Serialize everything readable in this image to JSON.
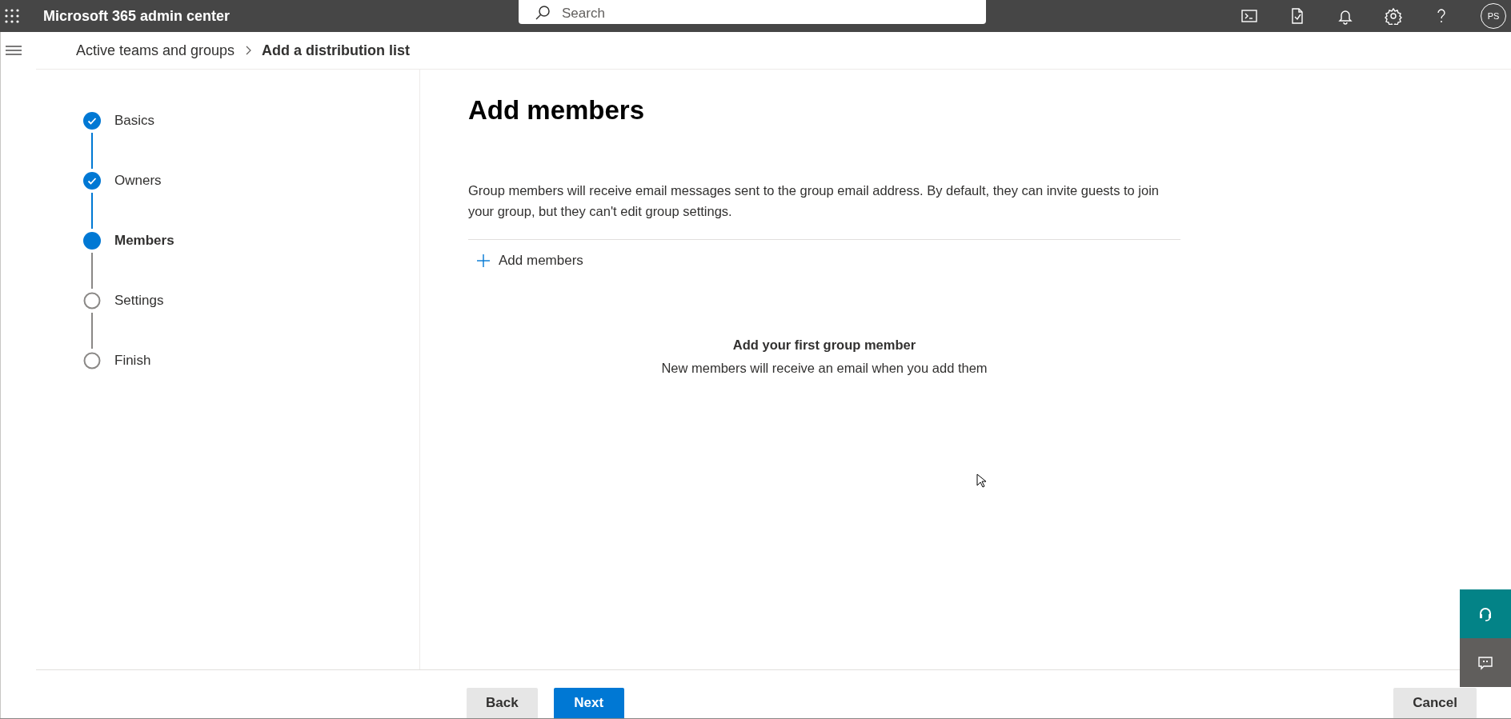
{
  "header": {
    "app_title": "Microsoft 365 admin center",
    "search": {
      "placeholder": "Search"
    },
    "avatar_initials": "PS"
  },
  "breadcrumb": [
    {
      "label": "Active teams and groups",
      "current": false
    },
    {
      "label": "Add a distribution list",
      "current": true
    }
  ],
  "steps": [
    {
      "label": "Basics",
      "completed": true,
      "selected": false
    },
    {
      "label": "Owners",
      "completed": true,
      "selected": false
    },
    {
      "label": "Members",
      "completed": false,
      "selected": true
    },
    {
      "label": "Settings",
      "completed": false,
      "selected": false
    },
    {
      "label": "Finish",
      "completed": false,
      "selected": false
    }
  ],
  "page": {
    "title": "Add members",
    "description": "Group members will receive email messages sent to the group email address. By default, they can invite guests to join your group, but they can't edit group settings.",
    "add_button": "Add members",
    "empty_title": "Add your first group member",
    "empty_text": "New members will receive an email when you add them"
  },
  "footer": {
    "buttons": [
      {
        "label": "Back",
        "kind": "secondary"
      },
      {
        "label": "Next",
        "kind": "primary"
      },
      {
        "label": "Cancel",
        "kind": "cancel"
      }
    ]
  }
}
